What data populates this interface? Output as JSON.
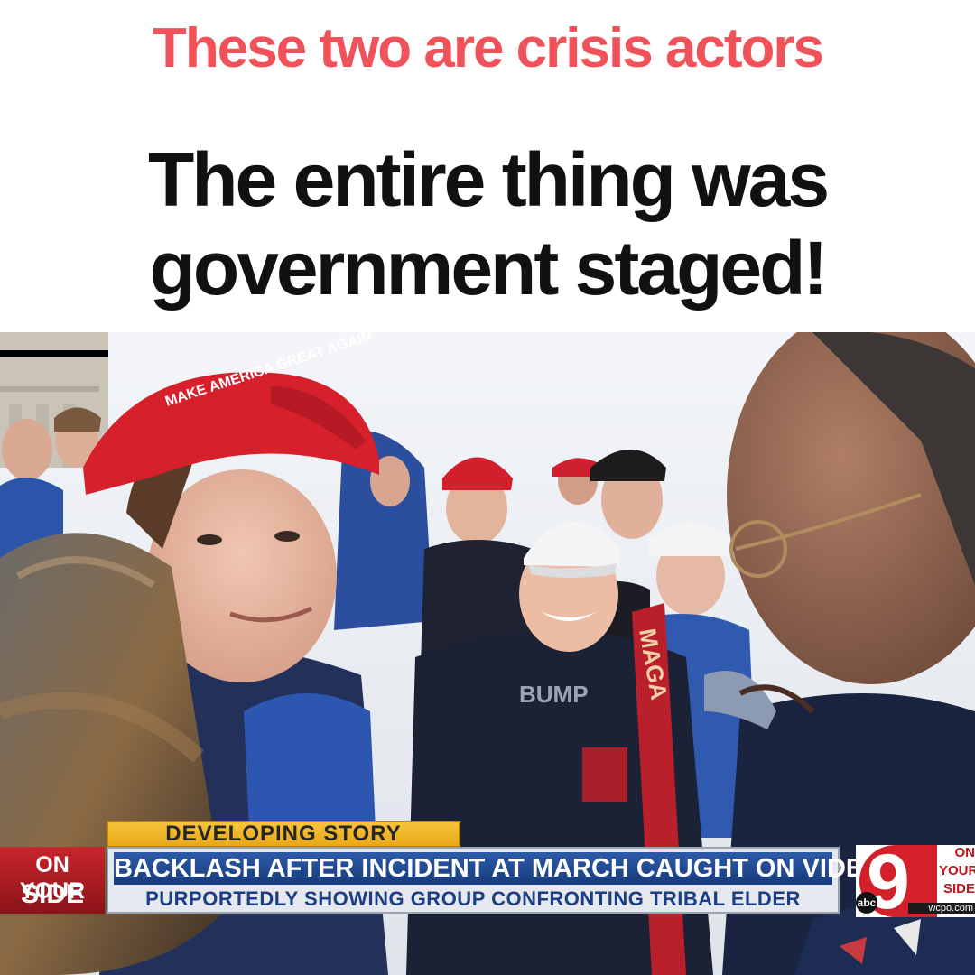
{
  "meme": {
    "kicker": "These two are crisis actors",
    "headline_line1": "The entire thing was",
    "headline_line2": "government staged!",
    "kicker_color": "#f0525a",
    "headline_color": "#111111"
  },
  "broadcast": {
    "banner": "DEVELOPING STORY",
    "bug_left_line1": "ON YOUR",
    "bug_left_line2": "SIDE",
    "headline": "BACKLASH AFTER INCIDENT AT MARCH CAUGHT ON VIDEO",
    "subheadline": "PURPORTEDLY SHOWING GROUP CONFRONTING TRIBAL ELDER",
    "station_number": "9",
    "network": "abc",
    "station_slogan_1": "ON",
    "station_slogan_2": "YOUR",
    "station_slogan_3": "SIDE",
    "station_web": "wcpo.com"
  },
  "photo_text": {
    "cap_front": "MAKE AMERICA GREAT AGAIN",
    "scarf": "MAGA"
  }
}
